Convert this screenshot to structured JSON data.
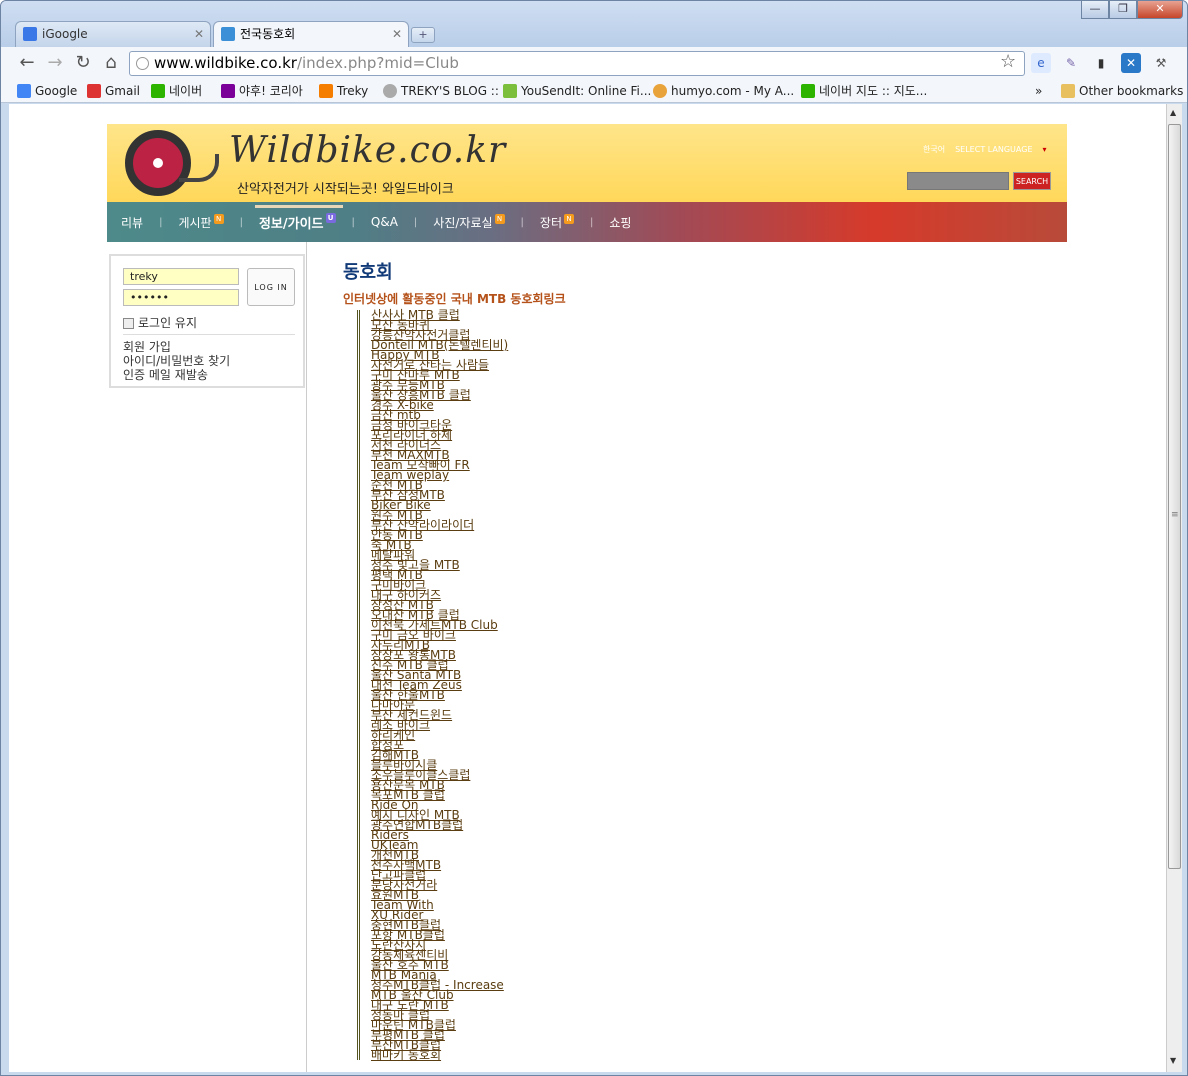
{
  "browser": {
    "tabs": [
      {
        "label": "iGoogle",
        "active": false
      },
      {
        "label": "전국동호회",
        "active": true
      }
    ],
    "new_tab": "+",
    "window_buttons": [
      "—",
      "❐",
      "✕"
    ],
    "url_host": "www.wildbike.co.kr",
    "url_path": "/index.php?mid=Club",
    "bookmarks": [
      "Google",
      "Gmail",
      "네이버",
      "야후! 코리아",
      "Treky",
      "TREKY'S BLOG ::",
      "YouSendIt: Online Fi...",
      "humyo.com - My A...",
      "네이버 지도 :: 지도..."
    ],
    "other_bookmarks": "Other bookmarks",
    "chevron": "»"
  },
  "site": {
    "logo_text": "Wildbike.co.kr",
    "tagline": "산악자전거가 시작되는곳! 와일드바이크",
    "lang_current": "한국어",
    "lang_select": "SELECT LANGUAGE",
    "search_btn": "SEARCH",
    "nav": [
      {
        "label": "리뷰",
        "badge": ""
      },
      {
        "label": "게시판",
        "badge": "N"
      },
      {
        "label": "정보/가이드",
        "badge": "U"
      },
      {
        "label": "Q&A",
        "badge": ""
      },
      {
        "label": "사진/자료실",
        "badge": "N"
      },
      {
        "label": "장터",
        "badge": "N"
      },
      {
        "label": "쇼핑",
        "badge": ""
      }
    ],
    "login": {
      "user": "treky",
      "password": "••••••",
      "button": "LOG IN",
      "keep": "로그인 유지",
      "links": [
        "회원 가입",
        "아이디/비밀번호 찾기",
        "인증 메일 재발송"
      ]
    },
    "page_title": "동호회",
    "page_subtitle": "인터넷상에 활동중인 국내 MTB 동호회링크",
    "clubs": [
      "산사사 MTB 클럽",
      "모산 동바퀴",
      "강릉산악자전거클럽",
      "Dontell MTB(돈텔렌티비)",
      "Happy MTB",
      "자전거로 산타는 사람들",
      "구미 산마루 MTB",
      "광주 무등MTB",
      "울산 장흥MTB 클럽",
      "경주 X-bike",
      "금산 mtb",
      "금정 바이크타운",
      "포리라이더 하체",
      "서천 라이더스",
      "부천 MAXMTB",
      "Team 모작빠이 FR",
      "Team weplay",
      "순천 MTB",
      "부산 삼정MTB",
      "Biker Bike",
      "원주 MTB",
      "부산 산악라이라이더",
      "안동 MTB",
      "죽 MTB",
      "메탈파워",
      "청주 빛고을 MTB",
      "평택 MTB",
      "구미바이크",
      "대구 하이커즈",
      "장성산 MTB",
      "오대산 MTB 클럽",
      "이천북 가세트MTB Club",
      "구미 금오 바이크",
      "자두리MTB",
      "장장포 왕통MTB",
      "진주 MTB 클럽",
      "울산 Santa MTB",
      "대전 Team Zeus",
      "울산 한울MTB",
      "다마아문",
      "부산 세컨드윈드",
      "레조 바이크",
      "하리케인",
      "합정포",
      "김해MTB",
      "블루바이시클",
      "조우블루이클스클럽",
      "용산문목 MTB",
      "목포MTB 클럽",
      "Ride On",
      "예지 디자인 MTB",
      "광주연합MTB클럽",
      "Riders",
      "UKTeam",
      "개천MTB",
      "천주자백MTB",
      "단고파클럽",
      "분당자전거라",
      "효원MTB",
      "Team With",
      "XU Rider",
      "충현MTB클럽",
      "포항 MTB클럽",
      "노란산사시",
      "강동체육센티비",
      "울산 호주 MTB",
      "MTB Mania",
      "청주MTB클럽 - Increase",
      "MTB 울산 Club",
      "대구 노란 MTB",
      "정동마 클럽",
      "마운틴 MTB클럽",
      "부평MTB 클럽",
      "부산MTB클럽",
      "배마키 동호회"
    ]
  }
}
